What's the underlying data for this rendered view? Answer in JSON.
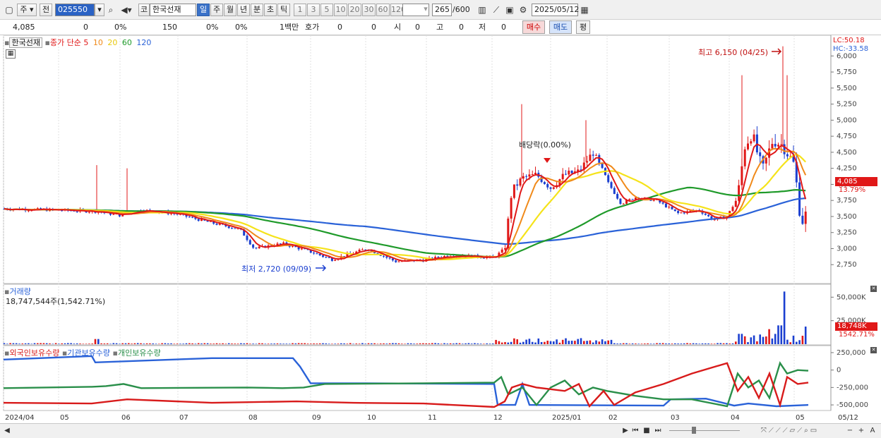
{
  "toolbar": {
    "chart_period_select": "주",
    "prev_button": "전",
    "stock_code": "025550",
    "market_button": "코",
    "stock_name": "한국선재",
    "period_tabs": [
      "일",
      "주",
      "월",
      "년",
      "분",
      "초",
      "틱"
    ],
    "active_period": "일",
    "interval_buttons": [
      "1",
      "3",
      "5",
      "10",
      "20",
      "30",
      "60",
      "120"
    ],
    "count_display": "265",
    "count_max": "/600",
    "date_value": "2025/05/12"
  },
  "quote": {
    "price": "4,085",
    "change": "0",
    "change_pct": "0%",
    "volume": "150",
    "vol_pct1": "0%",
    "vol_pct2": "0%",
    "unit": "1백만",
    "hoga_label": "호가",
    "hoga_v1": "0",
    "hoga_v2": "0",
    "open_label": "시",
    "open_v": "0",
    "high_label": "고",
    "high_v": "0",
    "low_label": "저",
    "low_v": "0",
    "buy_button": "매수",
    "sell_button": "매도",
    "avg_button": "평"
  },
  "price_panel": {
    "stock_label": "한국선재",
    "ma_title": "종가 단순 5",
    "ma_periods": [
      "10",
      "20",
      "60",
      "120"
    ],
    "lc_label": "LC:50.18",
    "hc_label": "HC:-33.58",
    "high_annotation": "최고 6,150 (04/25)",
    "low_annotation": "최저 2,720 (09/09)",
    "dividend_annotation": "배당락(0.00%)",
    "current_price_tag": "4,085",
    "current_pct": "13.79%",
    "y_ticks": [
      "6,000",
      "5,750",
      "5,500",
      "5,250",
      "5,000",
      "4,750",
      "4,500",
      "4,250",
      "4,000",
      "3,750",
      "3,500",
      "3,250",
      "3,000",
      "2,750"
    ]
  },
  "volume_panel": {
    "title": "거래량",
    "summary": "18,747,544주(1,542.71%)",
    "tag": "18,748K",
    "tag_pct": "1542.71%",
    "y_ticks": [
      "50,000K",
      "25,000K"
    ]
  },
  "holdings_panel": {
    "legend": [
      "외국인보유수량",
      "기관보유수량",
      "개인보유수량"
    ],
    "y_ticks": [
      "250,000",
      "0",
      "-250,000",
      "-500,000"
    ]
  },
  "x_axis": [
    "2024/04",
    "05",
    "06",
    "07",
    "08",
    "09",
    "10",
    "11",
    "12",
    "2025/01",
    "02",
    "03",
    "04",
    "05",
    "05/12"
  ],
  "colors": {
    "up": "#e01818",
    "down": "#1b3fd0",
    "ma5": "#e01818",
    "ma10": "#f08a1a",
    "ma20": "#f5e31a",
    "ma60": "#1f9a2a",
    "ma120": "#2a62d8",
    "foreign": "#d81b1b",
    "institution": "#2a62d8",
    "individual": "#2a8f4a"
  },
  "scrollbar": {
    "zoom_out": "−",
    "zoom_in": "+",
    "text_toggle": "A"
  }
}
